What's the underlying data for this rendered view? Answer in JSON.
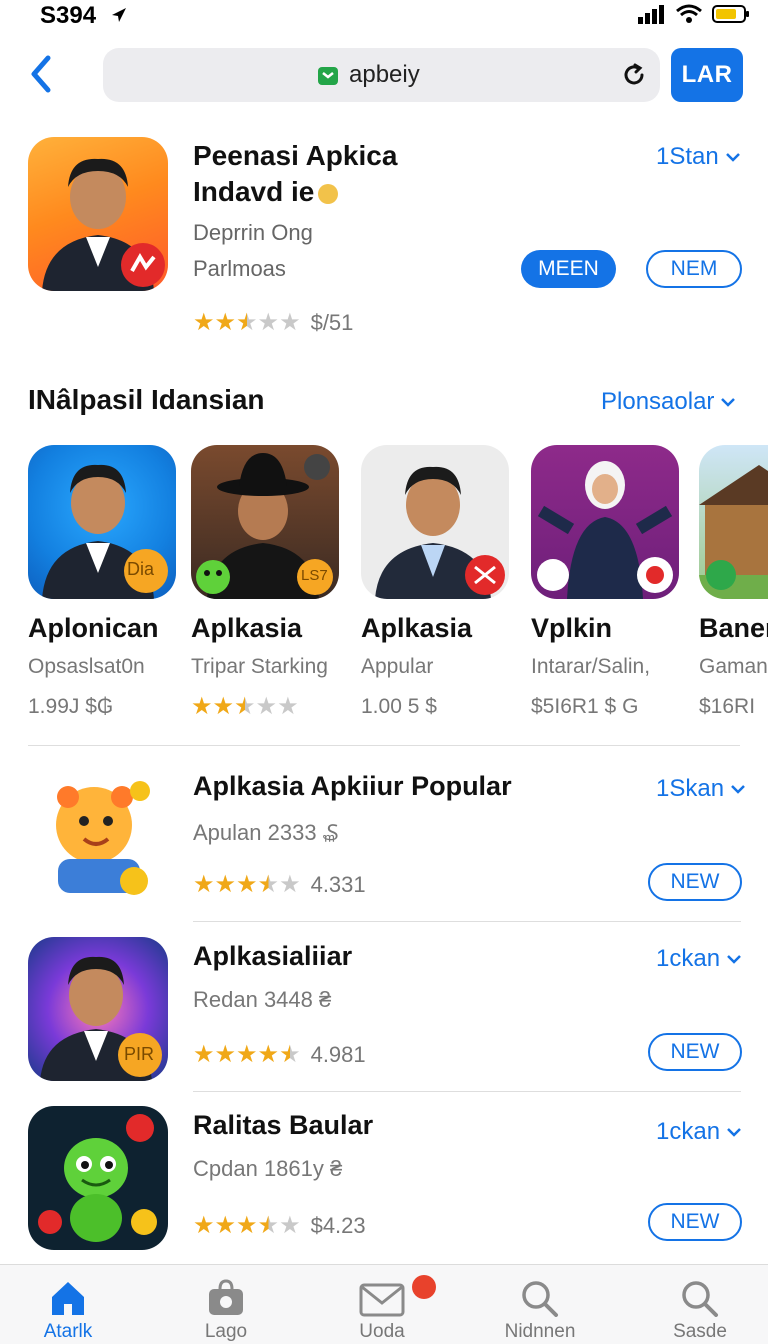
{
  "status_bar": {
    "time": "S394"
  },
  "search": {
    "url_text": "apbeiy",
    "action_label": "LAR"
  },
  "featured": {
    "title_line1": "Peenasi Apkica",
    "title_line2": "Indavd ie",
    "developer": "Deprrin Ong",
    "category": "Parlmoas",
    "rating_text": "$/51",
    "rating": 2.5,
    "link_label": "1Stan",
    "primary_button": "MEEN",
    "secondary_button": "NEM"
  },
  "section": {
    "title": "INâlpasil Idansian",
    "link_label": "Plonsaolar"
  },
  "carousel": [
    {
      "name": "Aplonican",
      "subtitle": "Opsaslsat0n",
      "price": "1.99J $₲",
      "rating": null,
      "badge_text": "Dia"
    },
    {
      "name": "Aplkasia",
      "subtitle": "Tripar Starking",
      "price": "",
      "rating": 2.5,
      "badge_text": "LS7"
    },
    {
      "name": "Aplkasia",
      "subtitle": "Appular",
      "price": "1.00 5 $",
      "rating": null,
      "badge_text": ""
    },
    {
      "name": "Vplkin",
      "subtitle": "Intarar/Salin,",
      "price": "$5I6R1 $ G",
      "rating": null,
      "badge_text": ""
    },
    {
      "name": "Banen",
      "subtitle": "Gaman",
      "price": "$16RI",
      "rating": null,
      "badge_text": ""
    }
  ],
  "list": [
    {
      "title": "Aplkasia Apkiiur Popular",
      "subtitle": "Apulan 2333 ₷",
      "rating": 3.5,
      "rating_text": "4.331",
      "link_label": "1Skan",
      "button": "NEW"
    },
    {
      "title": "Aplkasialiiar",
      "subtitle": "Redan 3448 ₴",
      "rating": 4.5,
      "rating_text": "4.981",
      "link_label": "1ckan",
      "button": "NEW",
      "badge_text": "PIR"
    },
    {
      "title": "Ralitas Baular",
      "subtitle": "Cpdan 1861y ₴",
      "rating": 3.5,
      "rating_text": "$4.23",
      "link_label": "1ckan",
      "button": "NEW"
    }
  ],
  "tabs": [
    {
      "label": "Atarlk",
      "icon": "home-icon",
      "active": true
    },
    {
      "label": "Lago",
      "icon": "bag-icon",
      "active": false
    },
    {
      "label": "Uoda",
      "icon": "mail-icon",
      "active": false
    },
    {
      "label": "Nidnnen",
      "icon": "search-icon",
      "active": false
    },
    {
      "label": "Sasde",
      "icon": "search-icon",
      "active": false
    }
  ],
  "colors": {
    "accent": "#1473e6",
    "star": "#f0a818",
    "badge_red": "#e8422c"
  }
}
